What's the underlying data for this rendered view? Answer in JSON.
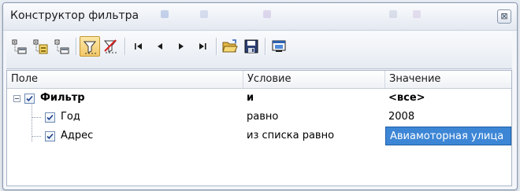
{
  "window": {
    "title": "Конструктор фильтра",
    "close_glyph": "⊠"
  },
  "toolbar": {
    "buttons": [
      {
        "name": "add-condition",
        "icon": "add-condition-icon"
      },
      {
        "name": "add-group",
        "icon": "add-group-icon"
      },
      {
        "name": "remove-condition",
        "icon": "remove-condition-icon"
      },
      {
        "name": "apply-filter",
        "icon": "filter-icon",
        "active": true
      },
      {
        "name": "clear-filter",
        "icon": "filter-clear-icon"
      },
      {
        "name": "first-record",
        "icon": "first-icon"
      },
      {
        "name": "prev-record",
        "icon": "prev-icon"
      },
      {
        "name": "next-record",
        "icon": "next-icon"
      },
      {
        "name": "last-record",
        "icon": "last-icon"
      },
      {
        "name": "open",
        "icon": "folder-open-icon"
      },
      {
        "name": "save",
        "icon": "save-icon"
      },
      {
        "name": "view",
        "icon": "window-icon"
      }
    ]
  },
  "grid": {
    "columns": [
      "Поле",
      "Условие",
      "Значение"
    ],
    "rows": [
      {
        "field": "Фильтр",
        "condition": "и",
        "value": "<все>",
        "bold": true,
        "checked": true
      },
      {
        "field": "Год",
        "condition": "равно",
        "value": "2008",
        "checked": true
      },
      {
        "field": "Адрес",
        "condition": "из списка равно",
        "value": "Авиамоторная улица",
        "checked": true,
        "selected_value": true
      }
    ]
  },
  "colors": {
    "selection": "#3d86d6",
    "accent_active": "#f3c96a"
  }
}
